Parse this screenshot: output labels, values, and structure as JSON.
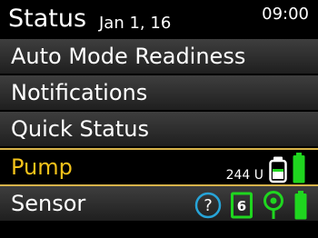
{
  "header": {
    "title": "Status",
    "date": "Jan 1, 16",
    "time": "09:00"
  },
  "menu": [
    {
      "label": "Auto Mode Readiness"
    },
    {
      "label": "Notifications"
    },
    {
      "label": "Quick Status"
    },
    {
      "label": "Pump",
      "selected": true,
      "units": "244 U"
    },
    {
      "label": "Sensor",
      "calibration_value": "6"
    }
  ],
  "icons": {
    "pump": [
      "reservoir-icon",
      "battery-icon"
    ],
    "sensor": [
      "help-icon",
      "calibration-icon",
      "sensor-connection-icon",
      "battery-icon"
    ]
  },
  "colors": {
    "selected_text": "#f2c21a",
    "selection_border": "#d7b34a",
    "battery_green": "#1fd61f",
    "help_cyan": "#27a4d8"
  }
}
